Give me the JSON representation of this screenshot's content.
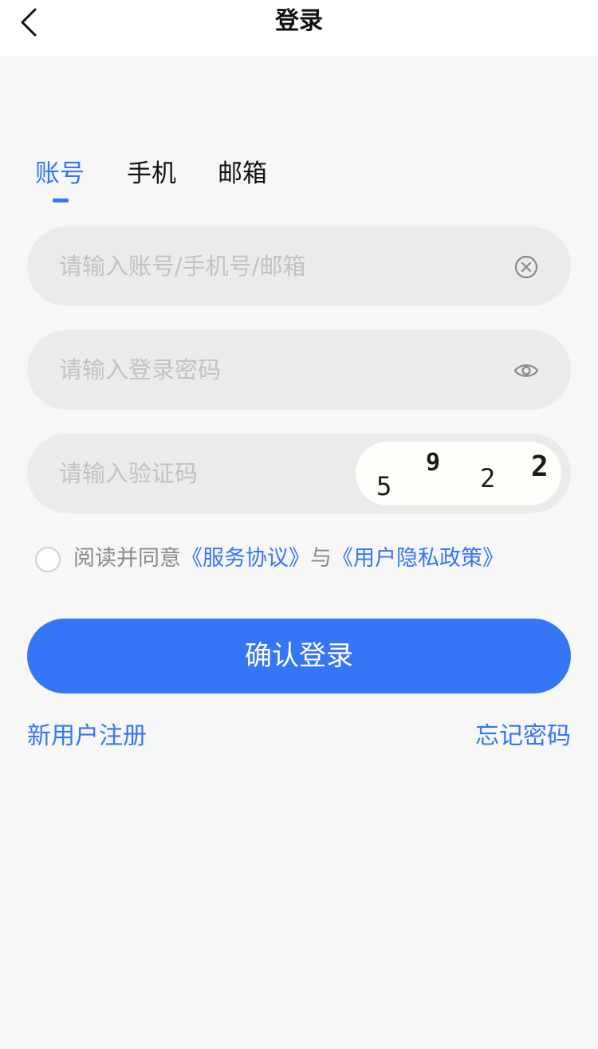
{
  "header": {
    "title": "登录",
    "back_icon": "chevron-left-icon"
  },
  "tabs": [
    {
      "label": "账号",
      "active": true
    },
    {
      "label": "手机",
      "active": false
    },
    {
      "label": "邮箱",
      "active": false
    }
  ],
  "form": {
    "account": {
      "value": "",
      "placeholder": "请输入账号/手机号/邮箱",
      "icon": "clear-icon"
    },
    "password": {
      "value": "",
      "placeholder": "请输入登录密码",
      "icon": "eye-icon"
    },
    "captcha": {
      "value": "",
      "placeholder": "请输入验证码",
      "digits": [
        "5",
        "9",
        "2",
        "2"
      ]
    }
  },
  "agreement": {
    "checked": false,
    "prefix": "阅读并同意",
    "terms_link": "《服务协议》",
    "connector": "与",
    "privacy_link": "《用户隐私政策》"
  },
  "submit_label": "确认登录",
  "links": {
    "register": "新用户注册",
    "forgot": "忘记密码"
  },
  "colors": {
    "accent": "#3576f6",
    "field_bg": "#ebebeb",
    "page_bg": "#f7f7f7",
    "placeholder": "#c2c2c2"
  }
}
